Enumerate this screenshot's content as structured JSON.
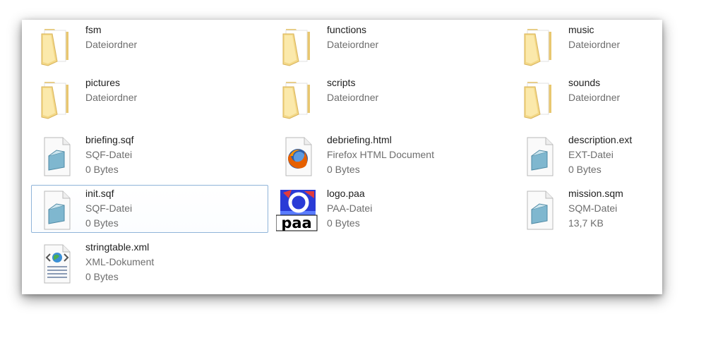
{
  "files": [
    {
      "name": "fsm",
      "type": "Dateiordner",
      "icon": "folder-icon"
    },
    {
      "name": "functions",
      "type": "Dateiordner",
      "icon": "folder-icon"
    },
    {
      "name": "music",
      "type": "Dateiordner",
      "icon": "folder-icon"
    },
    {
      "name": "pictures",
      "type": "Dateiordner",
      "icon": "folder-icon"
    },
    {
      "name": "scripts",
      "type": "Dateiordner",
      "icon": "folder-icon"
    },
    {
      "name": "sounds",
      "type": "Dateiordner",
      "icon": "folder-icon"
    },
    {
      "name": "briefing.sqf",
      "type": "SQF-Datei",
      "size": "0 Bytes",
      "icon": "notepad-document-icon"
    },
    {
      "name": "debriefing.html",
      "type": "Firefox HTML Document",
      "size": "0 Bytes",
      "icon": "firefox-icon"
    },
    {
      "name": "description.ext",
      "type": "EXT-Datei",
      "size": "0 Bytes",
      "icon": "notepad-document-icon"
    },
    {
      "name": "init.sqf",
      "type": "SQF-Datei",
      "size": "0 Bytes",
      "icon": "notepad-document-icon",
      "selected": true
    },
    {
      "name": "logo.paa",
      "type": "PAA-Datei",
      "size": "0 Bytes",
      "icon": "paa-image-icon",
      "logo_text": "paa"
    },
    {
      "name": "mission.sqm",
      "type": "SQM-Datei",
      "size": "13,7 KB",
      "icon": "notepad-document-icon"
    },
    {
      "name": "stringtable.xml",
      "type": "XML-Dokument",
      "size": "0 Bytes",
      "icon": "xml-document-icon"
    }
  ],
  "colors": {
    "selection_border": "#8fb4d9",
    "folder_light": "#fbe9a8",
    "folder_dark": "#e3c064",
    "secondary_text": "#6d6d6d"
  }
}
